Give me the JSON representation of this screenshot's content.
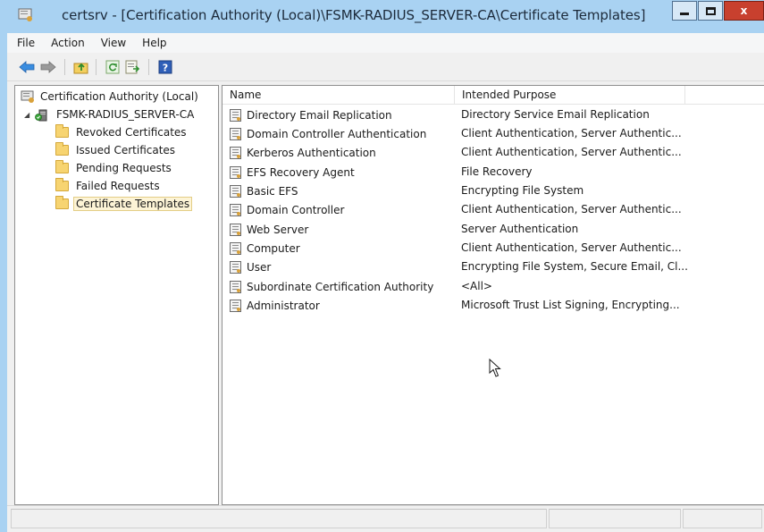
{
  "window": {
    "title": "certsrv - [Certification Authority (Local)\\FSMK-RADIUS_SERVER-CA\\Certificate Templates]",
    "minimize_label": "",
    "maximize_label": "",
    "close_label": "x",
    "titlebar_color": "#a9d2f2",
    "close_color": "#c8402e"
  },
  "menu": {
    "items": [
      "File",
      "Action",
      "View",
      "Help"
    ]
  },
  "toolbar": {
    "buttons": [
      "back-arrow-icon",
      "forward-arrow-icon",
      "up-folder-icon",
      "refresh-icon",
      "export-list-icon",
      "help-icon"
    ]
  },
  "tree": {
    "root": "Certification Authority (Local)",
    "ca": "FSMK-RADIUS_SERVER-CA",
    "items": [
      {
        "label": "Revoked Certificates",
        "selected": false
      },
      {
        "label": "Issued Certificates",
        "selected": false
      },
      {
        "label": "Pending Requests",
        "selected": false
      },
      {
        "label": "Failed Requests",
        "selected": false
      },
      {
        "label": "Certificate Templates",
        "selected": true
      }
    ]
  },
  "list": {
    "columns": [
      "Name",
      "Intended Purpose"
    ],
    "rows": [
      {
        "name": "Directory Email Replication",
        "purpose": "Directory Service Email Replication"
      },
      {
        "name": "Domain Controller Authentication",
        "purpose": "Client Authentication, Server Authentic..."
      },
      {
        "name": "Kerberos Authentication",
        "purpose": "Client Authentication, Server Authentic..."
      },
      {
        "name": "EFS Recovery Agent",
        "purpose": "File Recovery"
      },
      {
        "name": "Basic EFS",
        "purpose": "Encrypting File System"
      },
      {
        "name": "Domain Controller",
        "purpose": "Client Authentication, Server Authentic..."
      },
      {
        "name": "Web Server",
        "purpose": "Server Authentication"
      },
      {
        "name": "Computer",
        "purpose": "Client Authentication, Server Authentic..."
      },
      {
        "name": "User",
        "purpose": "Encrypting File System, Secure Email, Cl..."
      },
      {
        "name": "Subordinate Certification Authority",
        "purpose": "<All>"
      },
      {
        "name": "Administrator",
        "purpose": "Microsoft Trust List Signing, Encrypting..."
      }
    ]
  }
}
